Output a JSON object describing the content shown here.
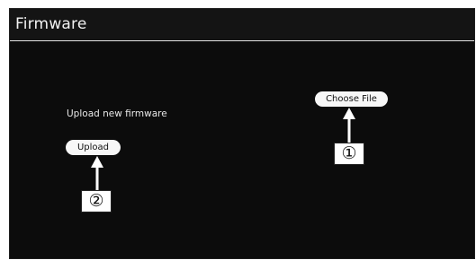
{
  "window": {
    "title": "Firmware"
  },
  "main": {
    "upload_label": "Upload new firmware",
    "choose_file_button": "Choose File",
    "upload_button": "Upload"
  },
  "callouts": {
    "one": "①",
    "two": "②"
  }
}
